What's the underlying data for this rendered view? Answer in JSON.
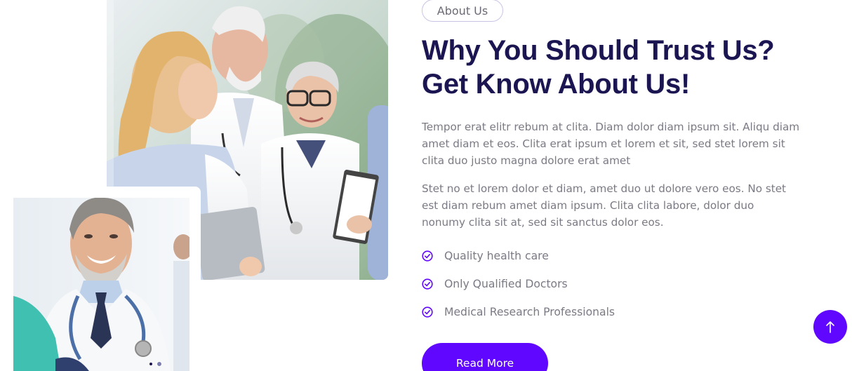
{
  "about": {
    "tag": "About Us",
    "title_line1": "Why You Should Trust Us?",
    "title_line2": "Get Know About Us!",
    "paragraph1": "Tempor erat elitr rebum at clita. Diam dolor diam ipsum sit. Aliqu diam amet diam et eos. Clita erat ipsum et lorem et sit, sed stet lorem sit clita duo justo magna dolore erat amet",
    "paragraph2": "Stet no et lorem dolor et diam, amet duo ut dolore vero eos. No stet est diam rebum amet diam ipsum. Clita clita labore, dolor duo nonumy clita sit at, sed sit sanctus dolor eos.",
    "features": [
      {
        "label": "Quality health care",
        "icon": "check-circle-icon"
      },
      {
        "label": "Only Qualified Doctors",
        "icon": "check-circle-icon"
      },
      {
        "label": "Medical Research Professionals",
        "icon": "check-circle-icon"
      }
    ],
    "button_label": "Read More"
  },
  "images": {
    "main": "doctors-team-photo",
    "small": "smiling-doctor-photo"
  },
  "back_to_top_icon": "arrow-up-icon",
  "colors": {
    "accent": "#5f07ff",
    "heading": "#1b1652",
    "body_text": "#7a7a84"
  }
}
